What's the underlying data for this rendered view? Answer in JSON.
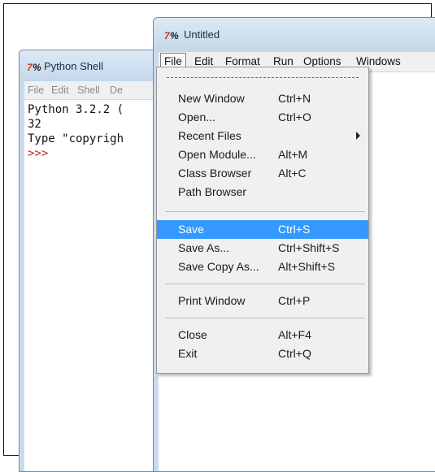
{
  "shell": {
    "title": "Python Shell",
    "menu": [
      "File",
      "Edit",
      "Shell",
      "De"
    ],
    "lines": [
      "Python 3.2.2 (",
      "32",
      "Type \"copyrigh"
    ],
    "prompt": ">>>"
  },
  "editor": {
    "title": "Untitled",
    "menu": [
      "File",
      "Edit",
      "Format",
      "Run",
      "Options",
      "Windows"
    ]
  },
  "file_menu": {
    "items": [
      {
        "label": "New Window",
        "accel": "Ctrl+N"
      },
      {
        "label": "Open...",
        "accel": "Ctrl+O"
      },
      {
        "label": "Recent Files",
        "accel": ""
      },
      {
        "label": "Open Module...",
        "accel": "Alt+M"
      },
      {
        "label": "Class Browser",
        "accel": "Alt+C"
      },
      {
        "label": "Path Browser",
        "accel": ""
      },
      {
        "label": "Save",
        "accel": "Ctrl+S"
      },
      {
        "label": "Save As...",
        "accel": "Ctrl+Shift+S"
      },
      {
        "label": "Save Copy As...",
        "accel": "Alt+Shift+S"
      },
      {
        "label": "Print Window",
        "accel": "Ctrl+P"
      },
      {
        "label": "Close",
        "accel": "Alt+F4"
      },
      {
        "label": "Exit",
        "accel": "Ctrl+Q"
      }
    ],
    "highlighted": "Save"
  },
  "colors": {
    "highlight": "#3399ff",
    "prompt": "#c0261a",
    "titlebar": "#c9dced"
  },
  "icons": {
    "app": "python-idle-icon",
    "submenu": "submenu-arrow-icon"
  }
}
